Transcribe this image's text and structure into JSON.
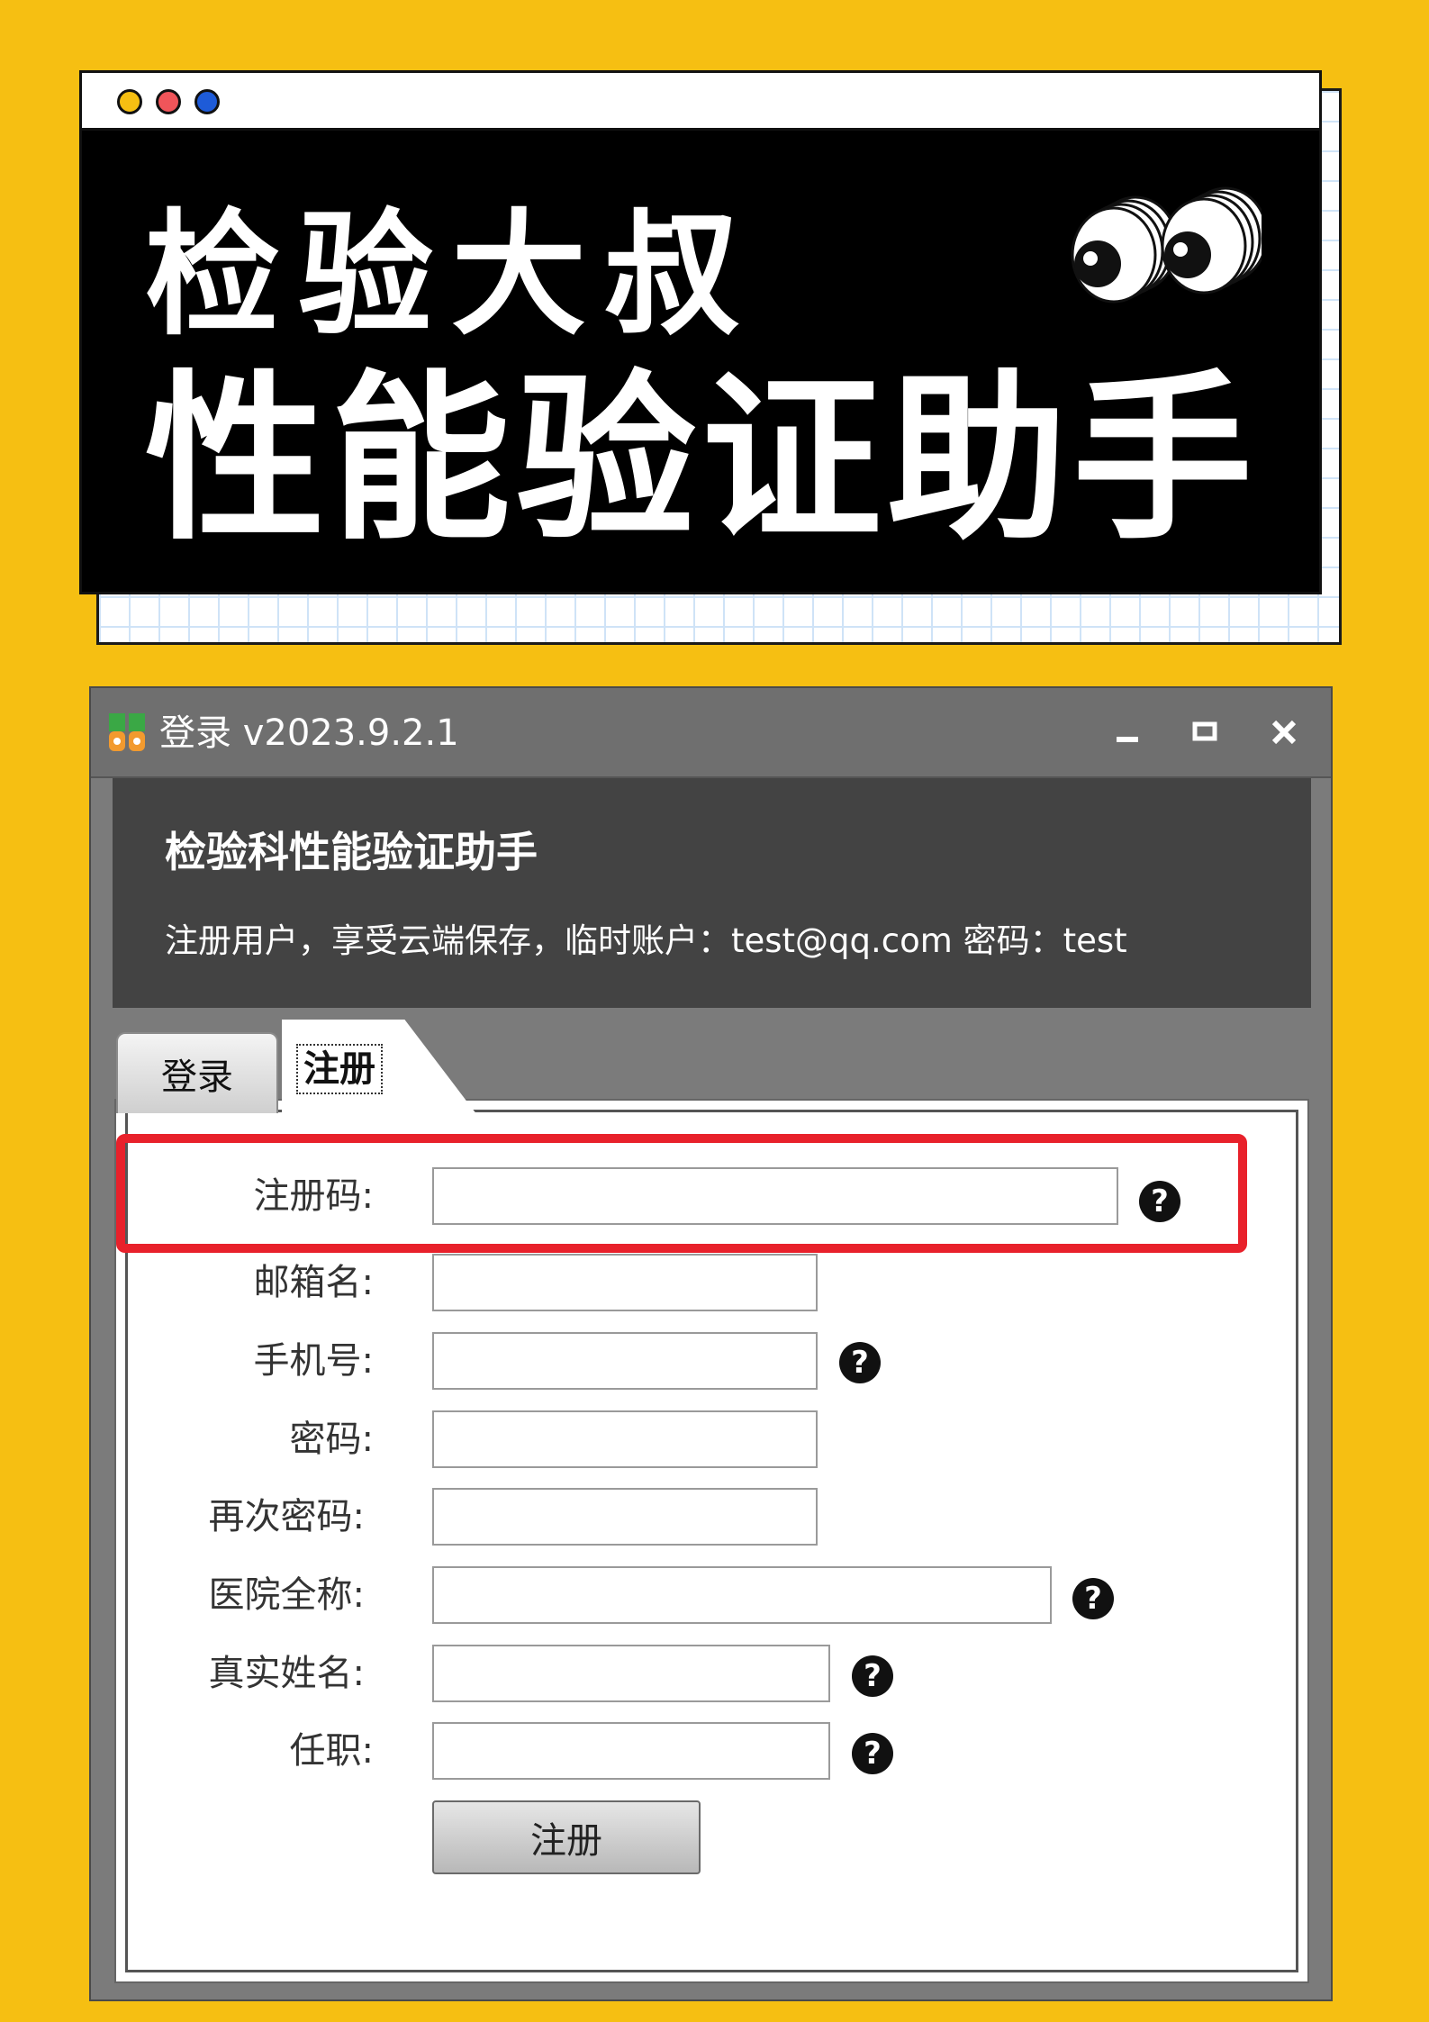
{
  "banner": {
    "line1": "检验大叔",
    "line2": "性能验证助手"
  },
  "window": {
    "title": "登录 v2023.9.2.1",
    "controls": {
      "minimize": "minimize-icon",
      "maximize": "maximize-icon",
      "close": "close-icon"
    }
  },
  "header": {
    "title": "检验科性能验证助手",
    "subtitle": "注册用户，享受云端保存，临时账户：test@qq.com 密码：test"
  },
  "tabs": [
    {
      "label": "登录",
      "active": false
    },
    {
      "label": "注册",
      "active": true
    }
  ],
  "form": {
    "fields": [
      {
        "label": "注册码:",
        "value": "",
        "help": true
      },
      {
        "label": "邮箱名:",
        "value": "",
        "help": false
      },
      {
        "label": "手机号:",
        "value": "",
        "help": true
      },
      {
        "label": "密码:",
        "value": "",
        "help": false
      },
      {
        "label": "再次密码:",
        "value": "",
        "help": false
      },
      {
        "label": "医院全称:",
        "value": "",
        "help": true
      },
      {
        "label": "真实姓名:",
        "value": "",
        "help": true
      },
      {
        "label": "任职:",
        "value": "",
        "help": true
      }
    ],
    "help_glyph": "?",
    "submit_label": "注册"
  },
  "colors": {
    "background": "#f6bf12",
    "highlight": "#e8212b",
    "titlebar": "#6f6f6f",
    "header": "#434343"
  }
}
